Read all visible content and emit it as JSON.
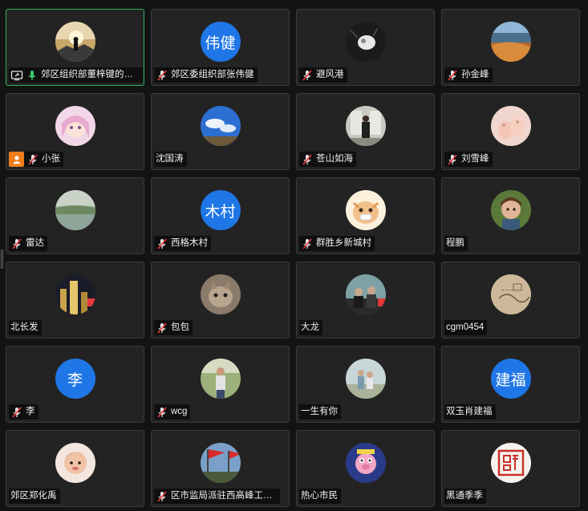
{
  "colors": {
    "active_border": "#2fb35a",
    "avatar_blue": "#1f76e6",
    "host_badge": "#ef7d1b",
    "mute_red": "#e5383b"
  },
  "participants": [
    {
      "name": "郊区组织部董梓键的屏幕共享",
      "avatar": "photo-silhouette",
      "mic": "on",
      "sharing": true
    },
    {
      "name": "郊区委组织部张伟健",
      "avatar_text": "伟健",
      "mic": "muted"
    },
    {
      "name": "避风港",
      "avatar": "photo-dark",
      "mic": "muted"
    },
    {
      "name": "孙金峰",
      "avatar": "photo-landscape",
      "mic": "muted"
    },
    {
      "name": "小张",
      "avatar": "photo-anime",
      "mic": "muted",
      "host": true
    },
    {
      "name": "沈国涛",
      "avatar": "photo-sky",
      "mic": "none"
    },
    {
      "name": "苍山如海",
      "avatar": "photo-person",
      "mic": "muted"
    },
    {
      "name": "刘雪峰",
      "avatar": "photo-baby",
      "mic": "muted"
    },
    {
      "name": "雷达",
      "avatar": "photo-lake",
      "mic": "muted"
    },
    {
      "name": "西格木村",
      "avatar_text": "木村",
      "mic": "muted"
    },
    {
      "name": "群胜乡新城村",
      "avatar": "photo-cartoon",
      "mic": "muted"
    },
    {
      "name": "程鹏",
      "avatar": "photo-child",
      "mic": "none"
    },
    {
      "name": "北长发",
      "avatar": "photo-city",
      "mic": "none"
    },
    {
      "name": "包包",
      "avatar": "photo-cat",
      "mic": "muted"
    },
    {
      "name": "大龙",
      "avatar": "photo-group",
      "mic": "none"
    },
    {
      "name": "cgm0454",
      "avatar": "photo-sketch",
      "mic": "none"
    },
    {
      "name": "李",
      "avatar_text": "李",
      "mic": "muted"
    },
    {
      "name": "wcg",
      "avatar": "photo-outdoor",
      "mic": "muted"
    },
    {
      "name": "一生有你",
      "avatar": "photo-family",
      "mic": "none"
    },
    {
      "name": "双玉肖建福",
      "avatar_text": "建福",
      "mic": "none"
    },
    {
      "name": "郊区郑化禹",
      "avatar": "photo-kid",
      "mic": "none"
    },
    {
      "name": "区市监局派驻西高峰工作队队员",
      "avatar": "photo-flag",
      "mic": "muted"
    },
    {
      "name": "热心市民",
      "avatar": "photo-pig",
      "mic": "none"
    },
    {
      "name": "黑通季季",
      "avatar": "photo-seal",
      "mic": "none"
    }
  ]
}
